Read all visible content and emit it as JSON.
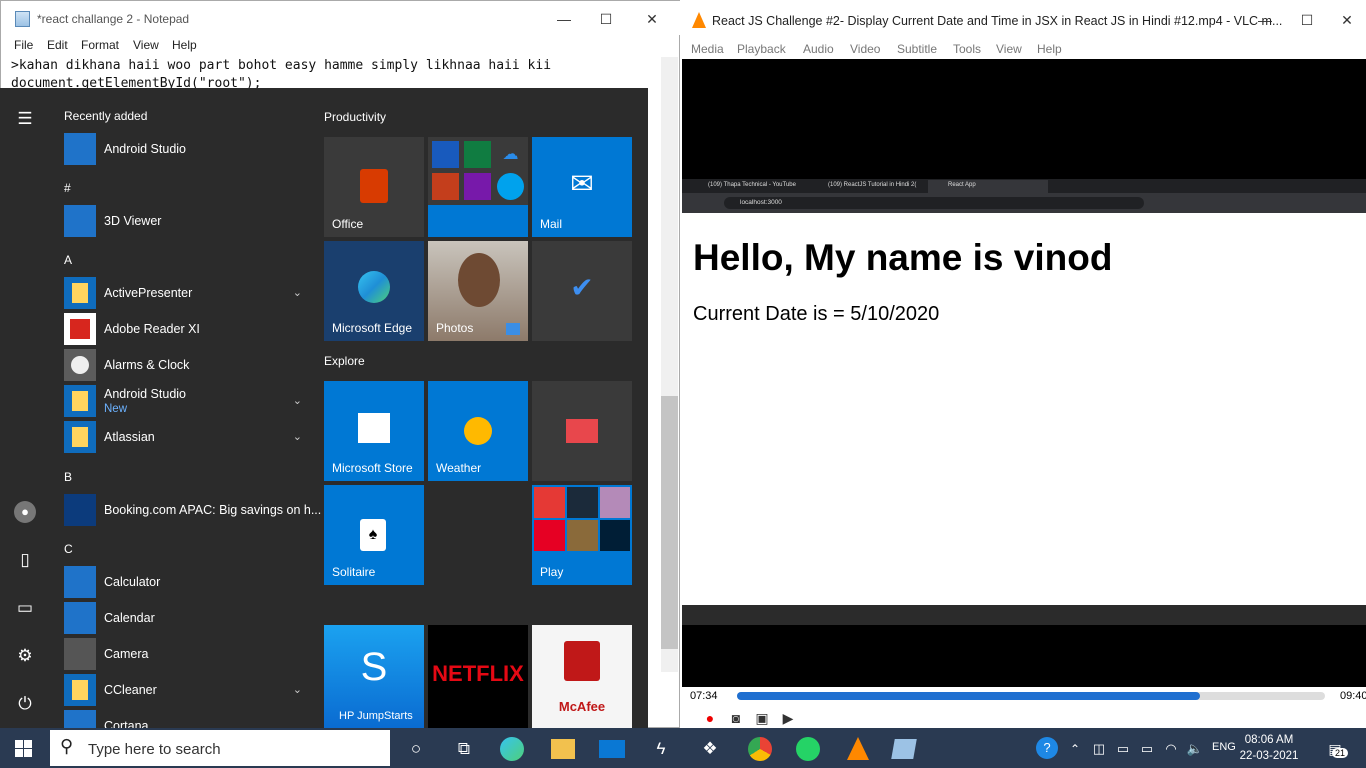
{
  "notepad": {
    "title": "*react challange 2 - Notepad",
    "menu": [
      "File",
      "Edit",
      "Format",
      "View",
      "Help"
    ],
    "lines": [
      ">kahan dikhana haii woo part bohot easy hamme simply likhnaa haii kii",
      "document.getElementById(\"root\");"
    ]
  },
  "start": {
    "recently_added": "Recently added",
    "productivity": "Productivity",
    "explore": "Explore",
    "apps": [
      {
        "name": "Android Studio",
        "sub": "",
        "icon": "android-studio-icon"
      },
      {
        "letter": "#"
      },
      {
        "name": "3D Viewer",
        "sub": "",
        "icon": "cube-icon"
      },
      {
        "letter": "A"
      },
      {
        "name": "ActivePresenter",
        "sub": "",
        "icon": "folder-icon",
        "chevron": true
      },
      {
        "name": "Adobe Reader XI",
        "sub": "",
        "icon": "pdf-icon"
      },
      {
        "name": "Alarms & Clock",
        "sub": "",
        "icon": "clock-icon"
      },
      {
        "name": "Android Studio",
        "sub": "New",
        "icon": "folder-icon",
        "chevron": true
      },
      {
        "name": "Atlassian",
        "sub": "",
        "icon": "folder-icon",
        "chevron": true
      },
      {
        "letter": "B"
      },
      {
        "name": "Booking.com APAC: Big savings on h...",
        "sub": "",
        "icon": "booking-icon"
      },
      {
        "letter": "C"
      },
      {
        "name": "Calculator",
        "sub": "",
        "icon": "calculator-icon"
      },
      {
        "name": "Calendar",
        "sub": "",
        "icon": "calendar-icon"
      },
      {
        "name": "Camera",
        "sub": "",
        "icon": "camera-icon"
      },
      {
        "name": "CCleaner",
        "sub": "",
        "icon": "folder-icon",
        "chevron": true
      },
      {
        "name": "Cortana",
        "sub": "",
        "icon": "cortana-icon"
      }
    ],
    "tiles": {
      "office": "Office",
      "mail": "Mail",
      "edge": "Microsoft Edge",
      "photos": "Photos",
      "store": "Microsoft Store",
      "weather": "Weather",
      "solitaire": "Solitaire",
      "play": "Play",
      "jumpstarts": "HP JumpStarts",
      "netflix": "NETFLIX",
      "mcafee": "McAfee"
    }
  },
  "vlc": {
    "title": "React JS Challenge #2- Display Current Date and Time in JSX in React JS in Hindi #12.mp4 - VLC m...",
    "menu": [
      "Media",
      "Playback",
      "Audio",
      "Video",
      "Subtitle",
      "Tools",
      "View",
      "Help"
    ],
    "time_elapsed": "07:34",
    "time_total": "09:40",
    "progress": 0.788,
    "browser": {
      "tabs": [
        "(109) Thapa Technical - YouTube",
        "(109) ReactJS Tutorial in Hindi 2(",
        "React App"
      ],
      "url": "localhost:3000",
      "heading": "Hello, My name is vinod",
      "paragraph": "Current Date is = 5/10/2020"
    }
  },
  "taskbar": {
    "search_placeholder": "Type here to search",
    "lang": "ENG",
    "time": "08:06 AM",
    "date": "22-03-2021",
    "notifications": "21"
  }
}
